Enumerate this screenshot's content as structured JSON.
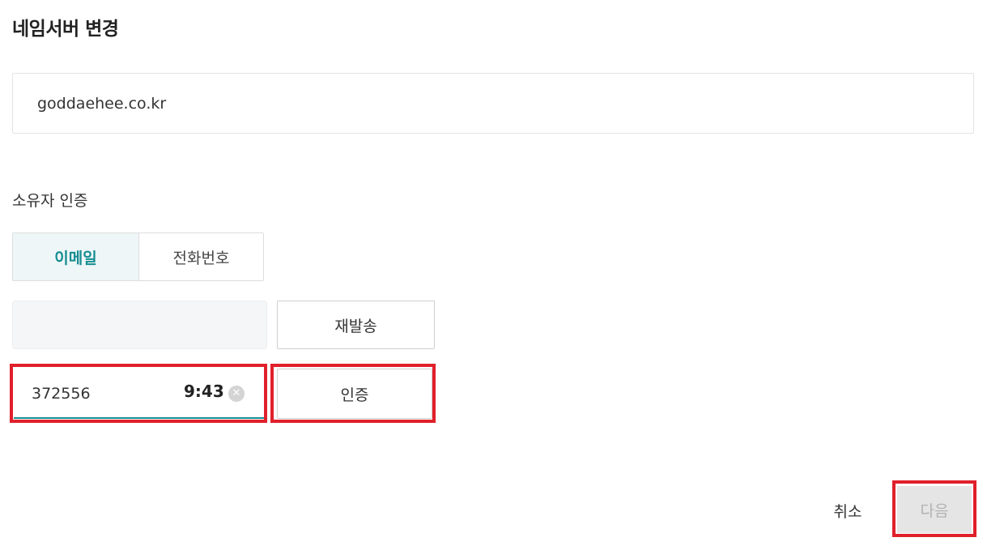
{
  "page": {
    "title": "네임서버 변경"
  },
  "domain": {
    "value": "goddaehee.co.kr"
  },
  "owner_verification": {
    "label": "소유자 인증",
    "tabs": [
      {
        "label": "이메일",
        "active": true
      },
      {
        "label": "전화번호",
        "active": false
      }
    ],
    "email_input_value": "",
    "resend_label": "재발송",
    "code": {
      "value": "372556",
      "timer": "9:43",
      "clear_icon": "clear-circle-icon"
    },
    "verify_label": "인증"
  },
  "footer": {
    "cancel_label": "취소",
    "next_label": "다음"
  },
  "colors": {
    "accent": "#168d91",
    "highlight": "#e0202a",
    "disabled_bg": "#e5e5e5"
  }
}
